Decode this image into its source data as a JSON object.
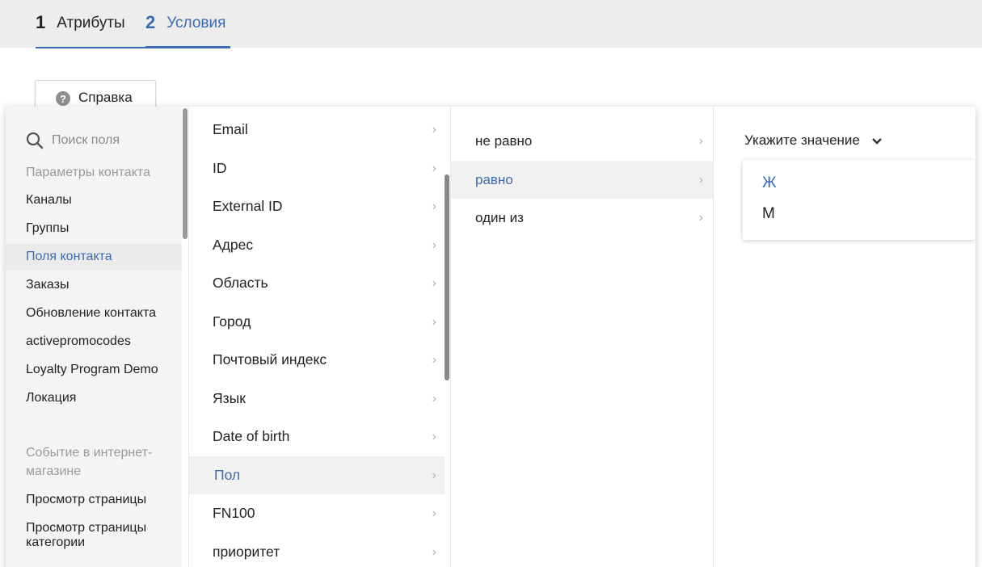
{
  "tabs": [
    {
      "num": "1",
      "label": "Атрибуты"
    },
    {
      "num": "2",
      "label": "Условия"
    }
  ],
  "help_button": {
    "label": "Справка",
    "icon": "question-circle-icon"
  },
  "fields_column": {
    "search_placeholder": "Поиск поля",
    "section1_header": "Параметры контакта",
    "section1_items": [
      "Каналы",
      "Группы",
      "Поля контакта",
      "Заказы",
      "Обновление контакта",
      "activepromocodes",
      "Loyalty Program Demo",
      "Локация"
    ],
    "active_item": "Поля контакта",
    "section2_header": "Событие в интернет-магазине",
    "section2_items": [
      "Просмотр страницы",
      "Просмотр страницы категории"
    ]
  },
  "contact_fields": [
    "Email",
    "ID",
    "External ID",
    "Адрес",
    "Область",
    "Город",
    "Почтовый индекс",
    "Язык",
    "Date of birth",
    "Пол",
    "FN100",
    "приоритет"
  ],
  "selected_field": "Пол",
  "operators": [
    "не равно",
    "равно",
    "один из"
  ],
  "selected_operator": "равно",
  "value_selector": {
    "label": "Укажите значение",
    "options": [
      "Ж",
      "М"
    ],
    "highlighted": "Ж"
  },
  "colors": {
    "accent": "#3b6cb3",
    "muted": "#999999"
  }
}
